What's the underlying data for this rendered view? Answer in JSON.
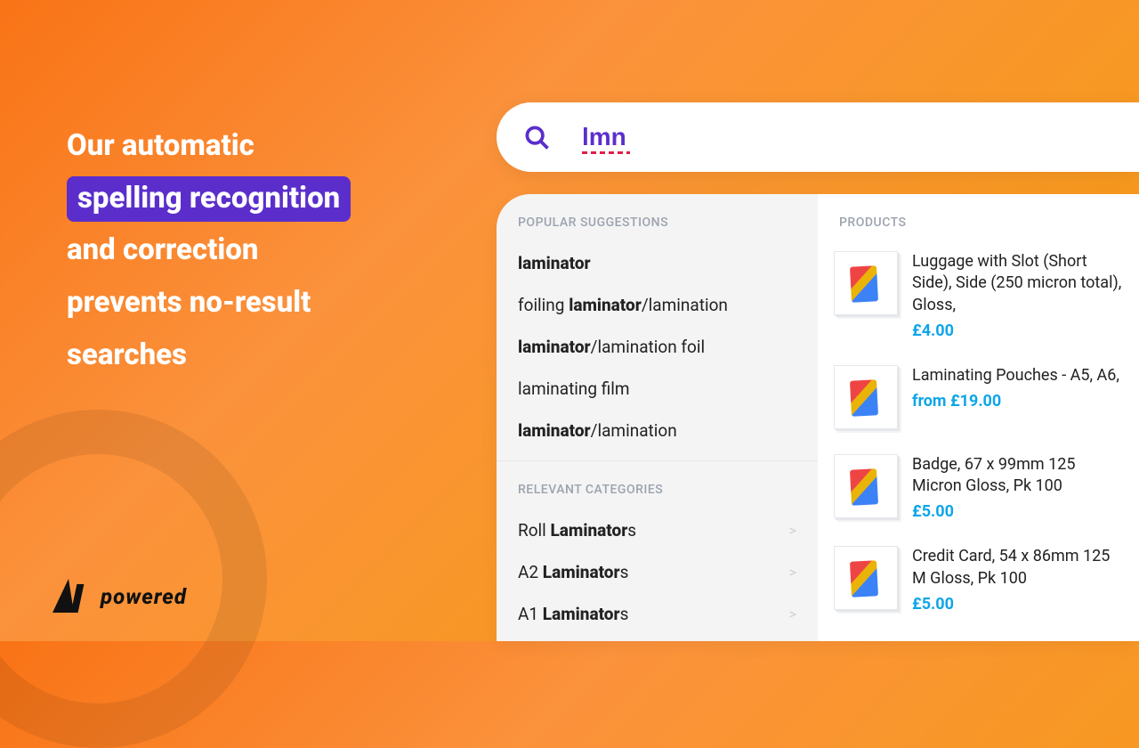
{
  "headline": {
    "line1": "Our automatic",
    "highlight": "spelling recognition",
    "line3": "and correction",
    "line4": "prevents no-result",
    "line5": "searches"
  },
  "badge": {
    "text": "powered"
  },
  "search": {
    "value": "lmn"
  },
  "suggestions": {
    "label": "POPULAR SUGGESTIONS",
    "items": [
      {
        "html": "<strong>laminator</strong>"
      },
      {
        "html": "foiling <strong>laminator</strong>/lamination"
      },
      {
        "html": "<strong>laminator</strong>/lamination foil"
      },
      {
        "html": "laminating film"
      },
      {
        "html": "<strong>laminator</strong>/lamination"
      }
    ]
  },
  "categories": {
    "label": "RELEVANT CATEGORIES",
    "items": [
      {
        "html": "Roll <strong>Laminator</strong>s"
      },
      {
        "html": "A2 <strong>Laminator</strong>s"
      },
      {
        "html": "A1 <strong>Laminator</strong>s"
      }
    ]
  },
  "products": {
    "label": "PRODUCTS",
    "items": [
      {
        "title": "Luggage with Slot (Short Side), Side (250 micron total), Gloss,",
        "price": "£4.00"
      },
      {
        "title": "Laminating Pouches - A5, A6, ",
        "price": "from £19.00"
      },
      {
        "title": "Badge, 67 x 99mm 125 Micron Gloss, Pk 100",
        "price": "£5.00"
      },
      {
        "title": "Credit Card, 54 x 86mm 125 M Gloss, Pk 100",
        "price": "£5.00"
      }
    ]
  }
}
